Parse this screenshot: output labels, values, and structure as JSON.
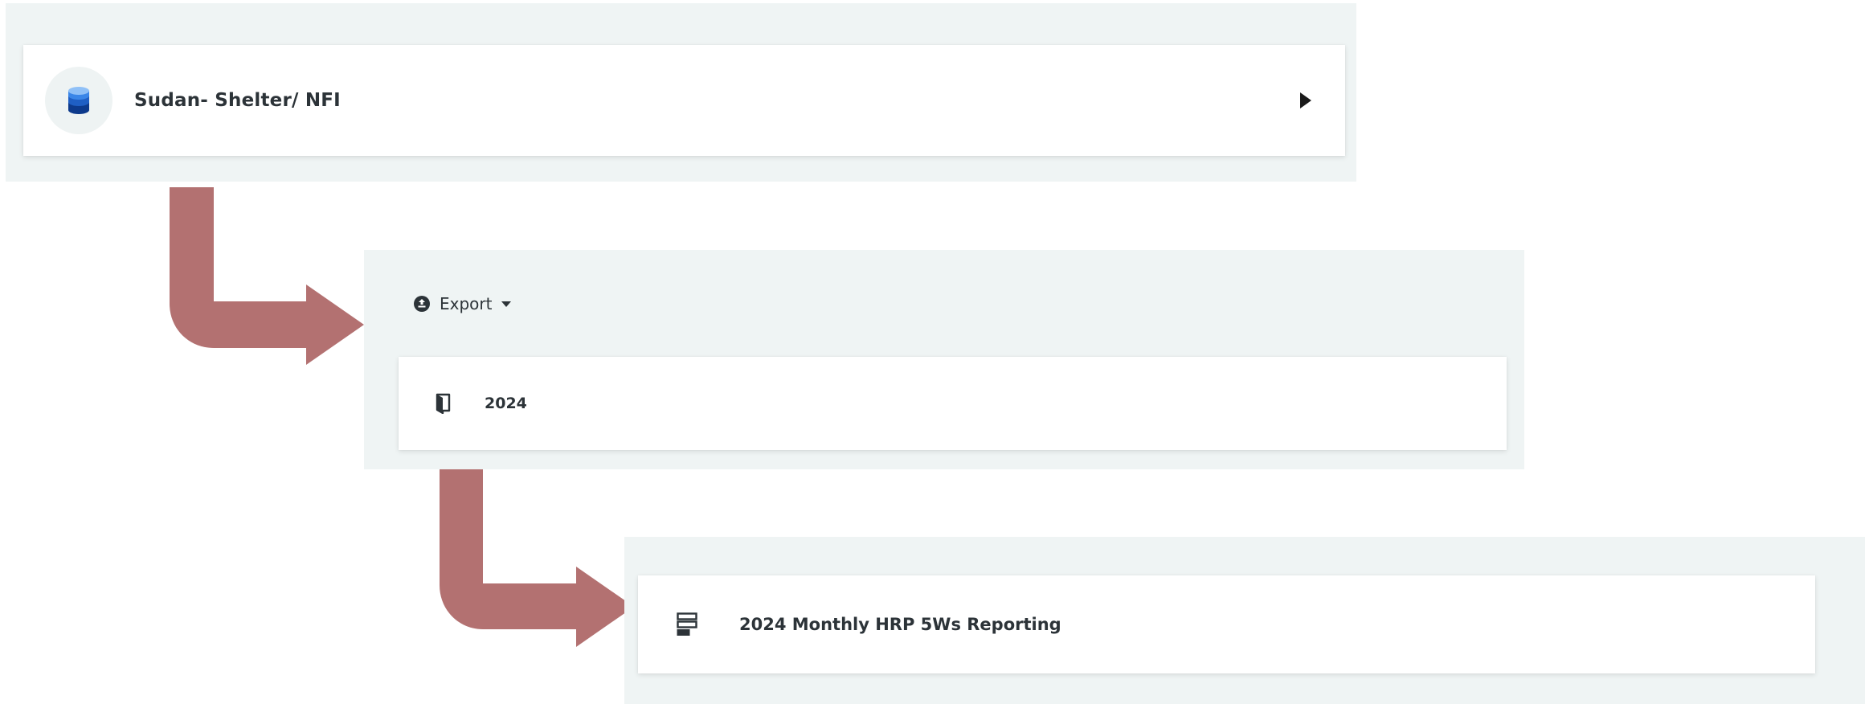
{
  "colors": {
    "panel_background": "#eff4f4",
    "card_background": "#ffffff",
    "connector_arrow": "#b37171",
    "text": "#2c3338",
    "database_icon": "#1f6fd1"
  },
  "level1": {
    "icon": "database-icon",
    "label": "Sudan- Shelter/ NFI",
    "expand_icon": "triangle-right-icon"
  },
  "level2": {
    "export": {
      "icon": "export-icon",
      "label": "Export",
      "caret_icon": "caret-down-icon"
    },
    "folder": {
      "icon": "folder-icon",
      "label": "2024"
    }
  },
  "level3": {
    "form": {
      "icon": "form-icon",
      "label": "2024 Monthly HRP 5Ws Reporting"
    }
  }
}
